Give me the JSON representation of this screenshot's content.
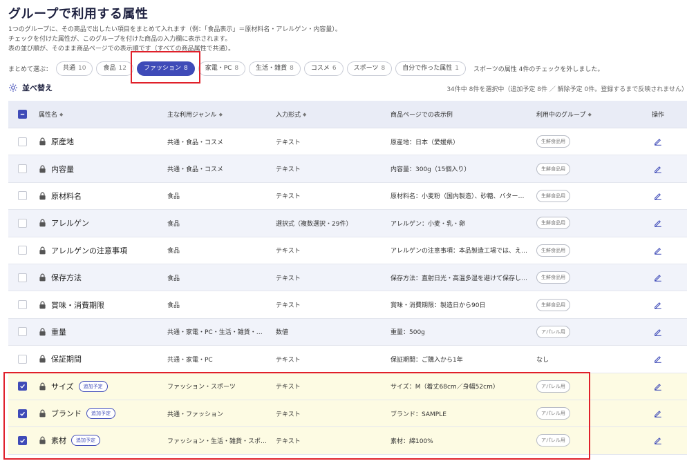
{
  "page": {
    "title": "グループで利用する属性",
    "description": [
      "1つのグループに、その商品で出したい項目をまとめて入れます（例：「食品表示」＝原材料名・アレルゲン・内容量）。",
      "チェックを付けた属性が、このグループを付けた商品の入力欄に表示されます。",
      "表の並び順が、そのまま商品ページでの表示順です（すべての商品属性で共通）。"
    ]
  },
  "chips": {
    "label": "まとめて選ぶ：",
    "items": [
      {
        "label": "共通",
        "count": "10",
        "active": false
      },
      {
        "label": "食品",
        "count": "12",
        "active": false
      },
      {
        "label": "ファッション",
        "count": "8",
        "active": true
      },
      {
        "label": "家電・PC",
        "count": "8",
        "active": false
      },
      {
        "label": "生活・雑貨",
        "count": "8",
        "active": false
      },
      {
        "label": "コスメ",
        "count": "6",
        "active": false
      },
      {
        "label": "スポーツ",
        "count": "8",
        "active": false
      },
      {
        "label": "自分で作った属性",
        "count": "1",
        "active": false
      }
    ],
    "status": "スポーツの属性 4件のチェックを外しました。"
  },
  "toolbar": {
    "sort_label": "並べ替え",
    "summary": "34件中 8件を選択中（追加予定 8件 ／ 解除予定 0件。登録するまで反映されません）"
  },
  "table": {
    "headers": {
      "name": "属性名",
      "genre": "主な利用ジャンル",
      "type": "入力形式",
      "example": "商品ページでの表示例",
      "groups": "利用中のグループ",
      "ops": "操作"
    },
    "rows": [
      {
        "checked": false,
        "name": "原産地",
        "tag": "",
        "genre": "共通・食品・コスメ",
        "type": "テキスト",
        "example": "原産地：日本（愛媛県）",
        "group": "生鮮食品用"
      },
      {
        "checked": false,
        "name": "内容量",
        "tag": "",
        "genre": "共通・食品・コスメ",
        "type": "テキスト",
        "example": "内容量：300g（15個入り）",
        "group": "生鮮食品用"
      },
      {
        "checked": false,
        "name": "原材料名",
        "tag": "",
        "genre": "食品",
        "type": "テキスト",
        "example": "原材料名：小麦粉（国内製造）、砂糖、バター…",
        "group": "生鮮食品用"
      },
      {
        "checked": false,
        "name": "アレルゲン",
        "tag": "",
        "genre": "食品",
        "type": "選択式（複数選択・29件）",
        "example": "アレルゲン：小麦・乳・卵",
        "group": "生鮮食品用"
      },
      {
        "checked": false,
        "name": "アレルゲンの注意事項",
        "tag": "",
        "genre": "食品",
        "type": "テキスト",
        "example": "アレルゲンの注意事項：本品製造工場では、え…",
        "group": "生鮮食品用"
      },
      {
        "checked": false,
        "name": "保存方法",
        "tag": "",
        "genre": "食品",
        "type": "テキスト",
        "example": "保存方法：直射日光・高温多湿を避けて保存し…",
        "group": "生鮮食品用"
      },
      {
        "checked": false,
        "name": "賞味・消費期限",
        "tag": "",
        "genre": "食品",
        "type": "テキスト",
        "example": "賞味・消費期限：製造日から90日",
        "group": "生鮮食品用"
      },
      {
        "checked": false,
        "name": "重量",
        "tag": "",
        "genre": "共通・家電・PC・生活・雑貨・…",
        "type": "数値",
        "example": "重量：500g",
        "group": "アパレル用"
      },
      {
        "checked": false,
        "name": "保証期間",
        "tag": "",
        "genre": "共通・家電・PC",
        "type": "テキスト",
        "example": "保証期間：ご購入から1年",
        "group": "",
        "group_text": "なし"
      },
      {
        "checked": true,
        "name": "サイズ",
        "tag": "追加予定",
        "genre": "ファッション・スポーツ",
        "type": "テキスト",
        "example": "サイズ：M（着丈68cm／身幅52cm）",
        "group": "アパレル用"
      },
      {
        "checked": true,
        "name": "ブランド",
        "tag": "追加予定",
        "genre": "共通・ファッション",
        "type": "テキスト",
        "example": "ブランド：SAMPLE",
        "group": "アパレル用"
      },
      {
        "checked": true,
        "name": "素材",
        "tag": "追加予定",
        "genre": "ファッション・生活・雑貨・スポ…",
        "type": "テキスト",
        "example": "素材：綿100%",
        "group": "アパレル用"
      }
    ]
  },
  "colors": {
    "accent": "#3f4bb8",
    "highlight": "#e0202a",
    "added_row": "#fdfbe3"
  }
}
